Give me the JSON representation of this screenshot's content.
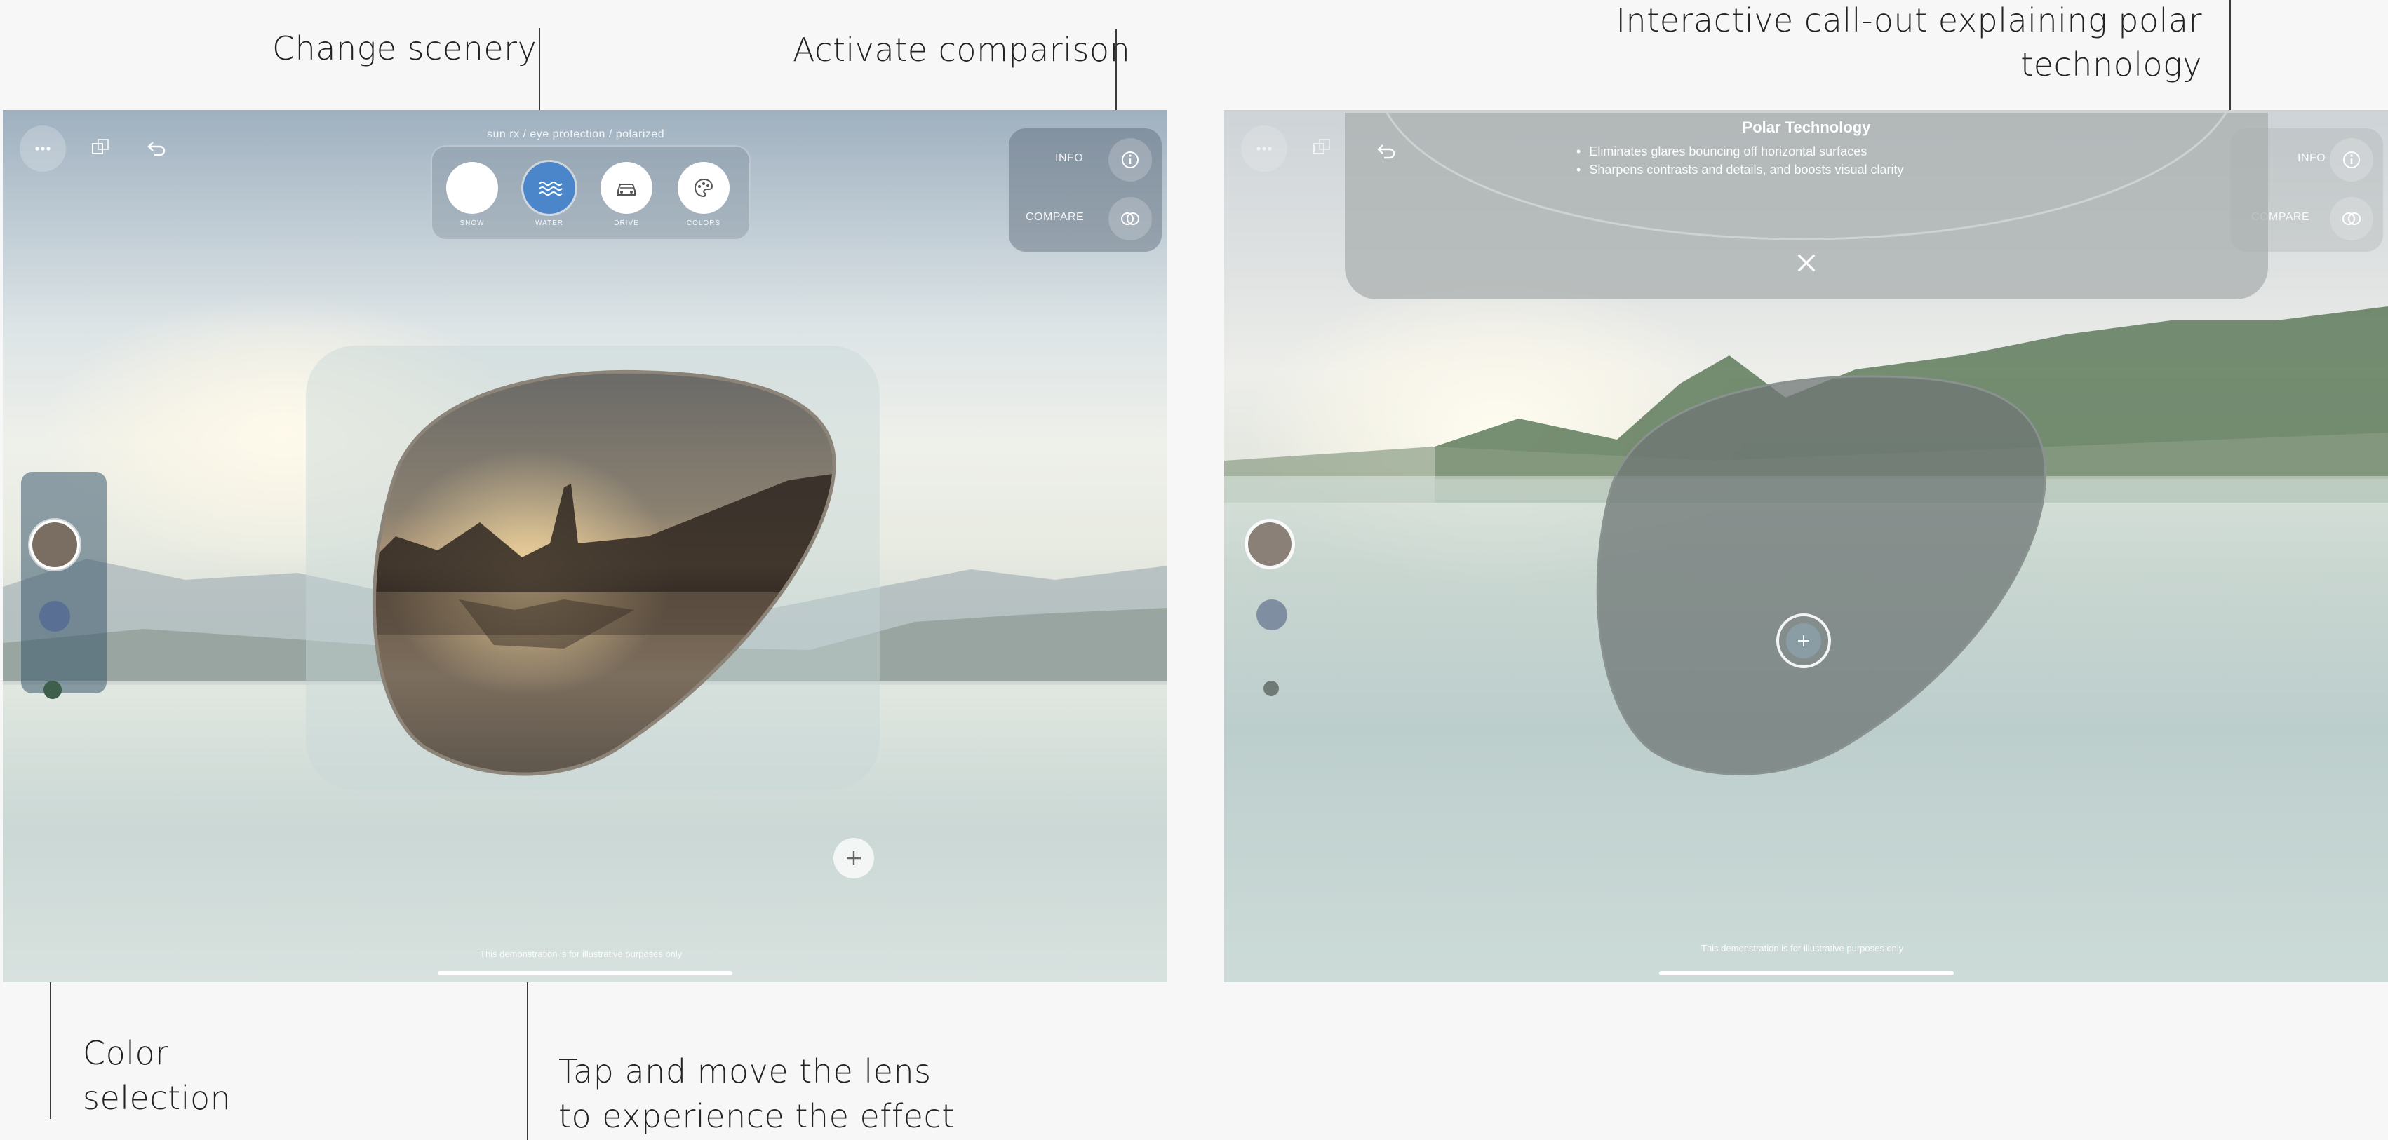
{
  "annotations": {
    "change_scenery": "Change scenery",
    "activate_comparison": "Activate comparison",
    "callout_line1": "Interactive call-out explaining polar",
    "callout_line2": "technology",
    "color_selection_line1": "Color",
    "color_selection_line2": "selection",
    "tap_move_line1": "Tap and move the lens",
    "tap_move_line2": "to experience the effect"
  },
  "left_screen": {
    "subtitle": "sun rx / eye protection / polarized",
    "scenery": [
      {
        "label": "SNOW",
        "icon": "snow-icon",
        "selected": false
      },
      {
        "label": "WATER",
        "icon": "water-icon",
        "selected": true
      },
      {
        "label": "DRIVE",
        "icon": "car-icon",
        "selected": false
      },
      {
        "label": "COLORS",
        "icon": "palette-icon",
        "selected": false
      }
    ],
    "compare_panel": {
      "info_label": "INFO",
      "compare_label": "COMPARE"
    },
    "color_swatches": [
      {
        "name": "brown",
        "color": "#7a6e62",
        "selected": true
      },
      {
        "name": "blue",
        "color": "#5a6f94",
        "selected": false
      },
      {
        "name": "green",
        "color": "#3d5f4c",
        "selected": false
      }
    ],
    "disclaimer": "This demonstration is for illustrative purposes only"
  },
  "right_screen": {
    "callout": {
      "title": "Polar Technology",
      "bullets": [
        "Eliminates glares bouncing off horizontal surfaces",
        "Sharpens contrasts and details, and boosts visual clarity"
      ]
    },
    "compare_panel": {
      "info_label": "INFO",
      "compare_label": "COMPARE"
    },
    "disclaimer": "This demonstration is for illustrative purposes only"
  },
  "colors": {
    "accent_water": "#4a86c9",
    "lens_tint": "#5e5a52",
    "panel_glass": "#8898a8"
  }
}
